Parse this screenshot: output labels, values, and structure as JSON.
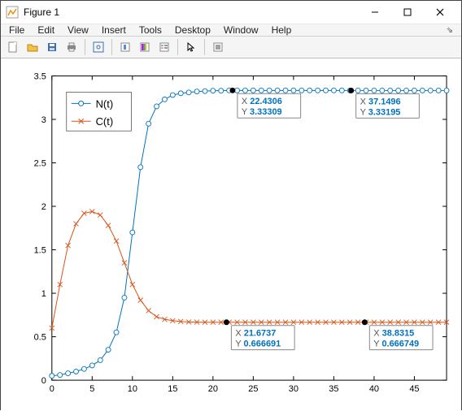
{
  "window": {
    "title": "Figure 1"
  },
  "menu": {
    "file": "File",
    "edit": "Edit",
    "view": "View",
    "insert": "Insert",
    "tools": "Tools",
    "desktop": "Desktop",
    "window": "Window",
    "help": "Help"
  },
  "toolbar_icons": {
    "new": "new-file-icon",
    "open": "open-folder-icon",
    "save": "save-icon",
    "print": "print-icon",
    "datacursor": "datacursor-icon",
    "link": "link-icon",
    "insert_colorbar": "insert-colorbar-icon",
    "legend": "legend-icon",
    "pointer": "pointer-icon",
    "edit_plot": "edit-plot-icon"
  },
  "legend": {
    "items": [
      "N(t)",
      "C(t)"
    ]
  },
  "datatips": [
    {
      "xlabel": "X",
      "x": "22.4306",
      "ylabel": "Y",
      "y": "3.33309"
    },
    {
      "xlabel": "X",
      "x": "37.1496",
      "ylabel": "Y",
      "y": "3.33195"
    },
    {
      "xlabel": "X",
      "x": "21.6737",
      "ylabel": "Y",
      "y": "0.666691"
    },
    {
      "xlabel": "X",
      "x": "38.8315",
      "ylabel": "Y",
      "y": "0.666749"
    }
  ],
  "chart_data": {
    "type": "line",
    "xlabel": "",
    "ylabel": "",
    "xlim": [
      0,
      49
    ],
    "ylim": [
      0,
      3.5
    ],
    "xticks": [
      0,
      5,
      10,
      15,
      20,
      25,
      30,
      35,
      40,
      45
    ],
    "yticks": [
      0,
      0.5,
      1,
      1.5,
      2,
      2.5,
      3,
      3.5
    ],
    "x": [
      0,
      1,
      2,
      3,
      4,
      5,
      6,
      7,
      8,
      9,
      10,
      11,
      12,
      13,
      14,
      15,
      16,
      17,
      18,
      19,
      20,
      21,
      22,
      23,
      24,
      25,
      26,
      27,
      28,
      29,
      30,
      31,
      32,
      33,
      34,
      35,
      36,
      37,
      38,
      39,
      40,
      41,
      42,
      43,
      44,
      45,
      46,
      47,
      48,
      49
    ],
    "series": [
      {
        "name": "N(t)",
        "color": "#0072bd",
        "marker": "o",
        "values": [
          0.05,
          0.06,
          0.08,
          0.1,
          0.13,
          0.17,
          0.23,
          0.35,
          0.55,
          0.95,
          1.7,
          2.45,
          2.95,
          3.15,
          3.23,
          3.28,
          3.3,
          3.31,
          3.32,
          3.325,
          3.33,
          3.33,
          3.333,
          3.333,
          3.333,
          3.333,
          3.333,
          3.333,
          3.333,
          3.333,
          3.333,
          3.333,
          3.333,
          3.333,
          3.333,
          3.333,
          3.333,
          3.332,
          3.332,
          3.332,
          3.332,
          3.332,
          3.332,
          3.332,
          3.332,
          3.332,
          3.332,
          3.332,
          3.332,
          3.332
        ]
      },
      {
        "name": "C(t)",
        "color": "#d95319",
        "marker": "x",
        "values": [
          0.6,
          1.1,
          1.55,
          1.8,
          1.92,
          1.94,
          1.9,
          1.78,
          1.6,
          1.35,
          1.1,
          0.92,
          0.8,
          0.73,
          0.7,
          0.685,
          0.675,
          0.67,
          0.668,
          0.667,
          0.667,
          0.667,
          0.667,
          0.667,
          0.667,
          0.667,
          0.667,
          0.667,
          0.667,
          0.667,
          0.667,
          0.667,
          0.667,
          0.667,
          0.667,
          0.667,
          0.667,
          0.667,
          0.667,
          0.667,
          0.667,
          0.667,
          0.667,
          0.667,
          0.667,
          0.667,
          0.667,
          0.667,
          0.667,
          0.667
        ]
      }
    ]
  }
}
